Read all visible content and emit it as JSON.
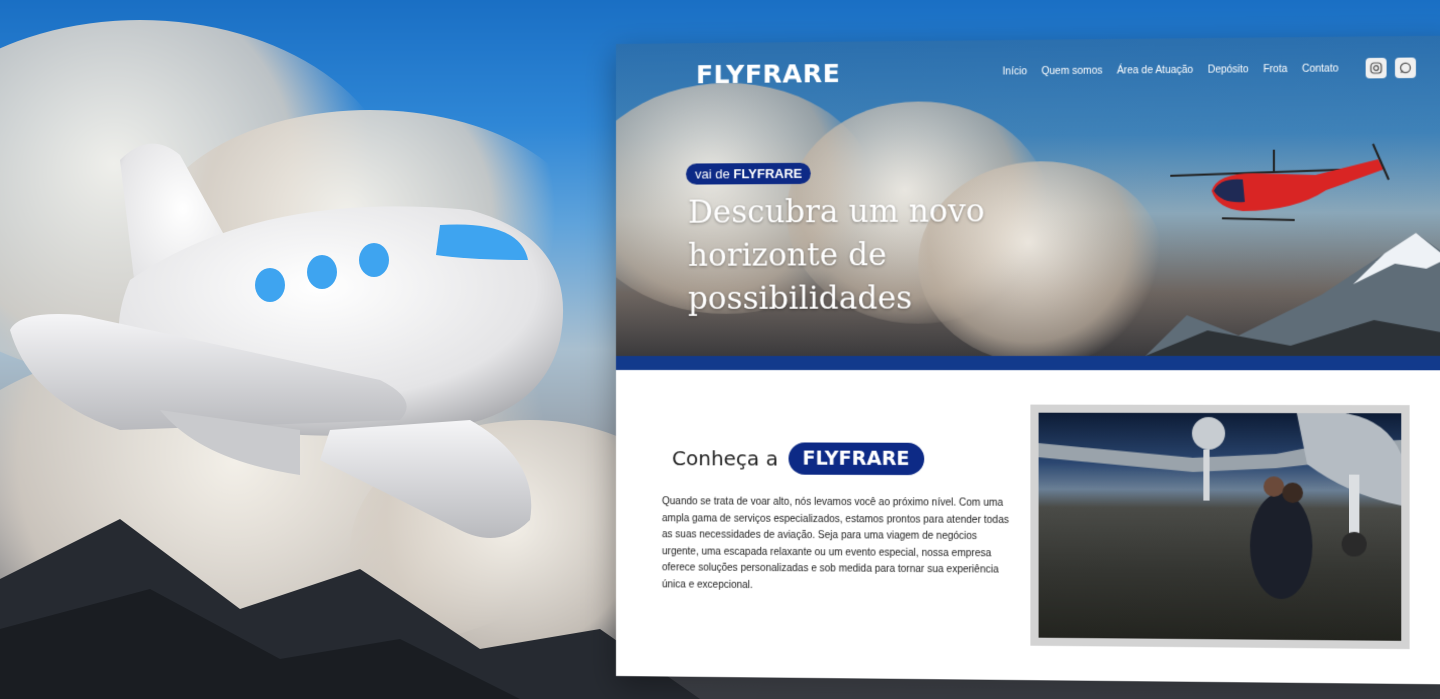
{
  "site": {
    "logo": "FLYFRARE",
    "nav": [
      "Início",
      "Quem somos",
      "Área de Atuação",
      "Depósito",
      "Frota",
      "Contato"
    ],
    "social": [
      {
        "icon": "instagram-icon"
      },
      {
        "icon": "whatsapp-icon"
      }
    ]
  },
  "hero": {
    "badge_prefix": "vai de",
    "badge_brand": "FLYFRARE",
    "headline": "Descubra um novo horizonte de possibilidades"
  },
  "about": {
    "title_prefix": "Conheça a",
    "title_brand": "FLYFRARE",
    "text": "Quando se trata de voar alto, nós levamos você ao próximo nível. Com uma ampla gama de serviços especializados, estamos prontos para atender todas as suas necessidades de aviação. Seja para uma viagem de negócios urgente, uma escapada relaxante ou um evento especial, nossa empresa oferece soluções personalizadas e sob medida para tornar sua experiência única e excepcional."
  },
  "colors": {
    "brand_navy": "#0d2a86",
    "band_blue": "#123a8c",
    "sky_blue": "#1a6fc4"
  }
}
